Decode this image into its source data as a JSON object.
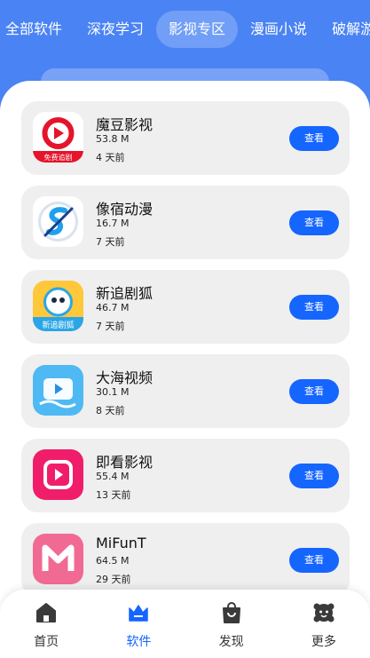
{
  "top_tabs": [
    "全部软件",
    "深夜学习",
    "影视专区",
    "漫画小说",
    "破解游戏"
  ],
  "active_tab_index": 2,
  "apps": [
    {
      "name": "魔豆影视",
      "size": "53.8 M",
      "time": "4 天前",
      "icon": "modou-icon",
      "badge": "免费追剧"
    },
    {
      "name": "像宿动漫",
      "size": "16.7 M",
      "time": "7 天前",
      "icon": "xiangsu-icon"
    },
    {
      "name": "新追剧狐",
      "size": "46.7 M",
      "time": "7 天前",
      "icon": "zhujuhu-icon",
      "badge": "新追剧狐"
    },
    {
      "name": "大海视频",
      "size": "30.1 M",
      "time": "8 天前",
      "icon": "dahai-icon"
    },
    {
      "name": "即看影视",
      "size": "55.4 M",
      "time": "13 天前",
      "icon": "jikan-icon"
    },
    {
      "name": "MiFunT",
      "size": "64.5 M",
      "time": "29 天前",
      "icon": "mifunt-icon"
    }
  ],
  "view_button_label": "查看",
  "bottom_nav": [
    {
      "label": "首页",
      "icon": "home-icon"
    },
    {
      "label": "软件",
      "icon": "crown-icon",
      "active": true
    },
    {
      "label": "发现",
      "icon": "bag-icon"
    },
    {
      "label": "更多",
      "icon": "more-icon"
    }
  ],
  "colors": {
    "header_bg": "#4a83f4",
    "accent": "#1565ff",
    "card_bg": "#efefef"
  }
}
